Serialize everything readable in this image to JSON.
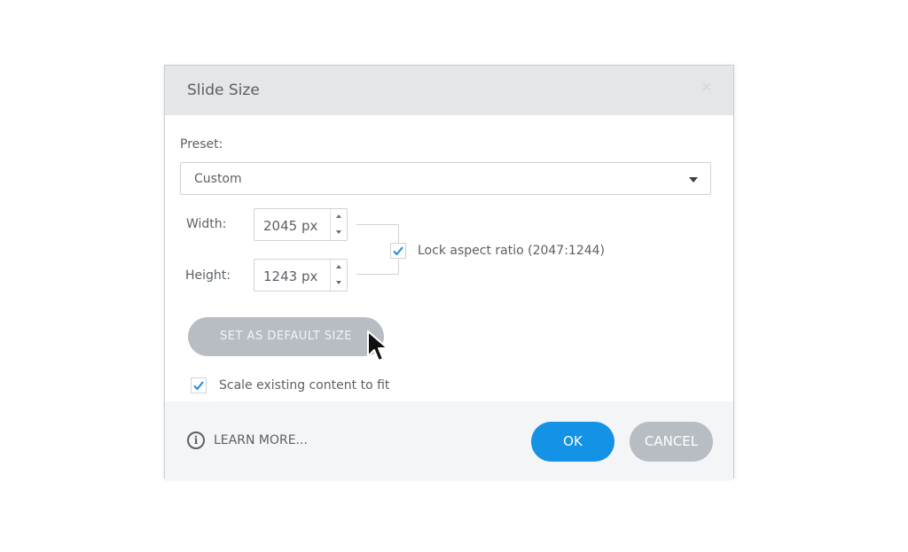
{
  "dialog": {
    "title": "Slide Size",
    "close_glyph": "×"
  },
  "preset": {
    "label": "Preset:",
    "value": "Custom"
  },
  "width": {
    "label": "Width:",
    "value": "2045 px"
  },
  "height": {
    "label": "Height:",
    "value": "1243 px"
  },
  "lock": {
    "label": "Lock aspect ratio (2047:1244)",
    "checked": true
  },
  "default_button": {
    "label": "SET AS DEFAULT SIZE"
  },
  "scale": {
    "label": "Scale existing content to fit",
    "checked": true
  },
  "footer": {
    "info_glyph": "i",
    "learn_more": "LEARN MORE...",
    "ok": "OK",
    "cancel": "CANCEL"
  },
  "icons": {
    "close": "close-icon",
    "dropdown": "chevron-down-icon",
    "check": "check-icon",
    "info": "info-icon",
    "cursor": "mouse-pointer-icon"
  },
  "colors": {
    "accent": "#1492e6",
    "check": "#1a8ee0",
    "disabled_button": "#b7bdc3",
    "titlebar": "#e4e6e8"
  }
}
